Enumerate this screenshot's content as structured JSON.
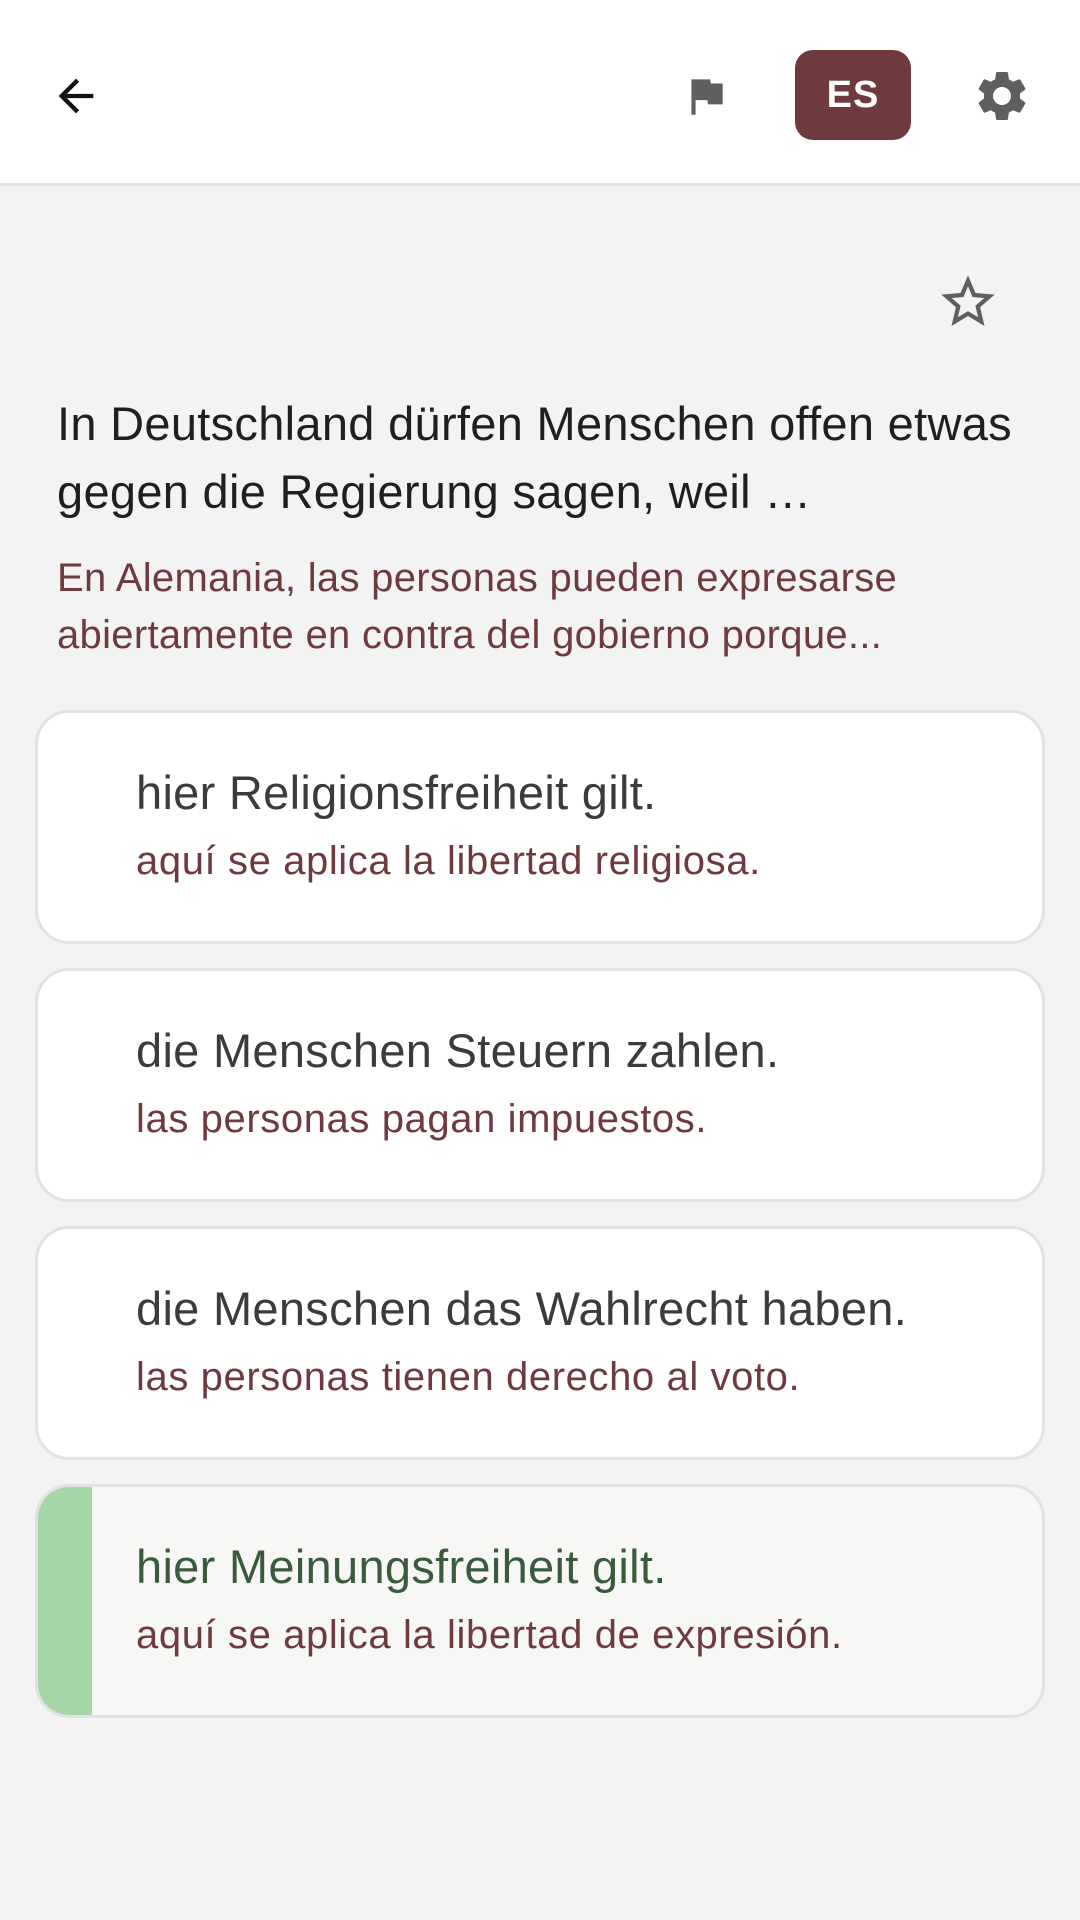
{
  "header": {
    "back_icon": "arrow-left-icon",
    "flag_icon": "flag-icon",
    "language_label": "ES",
    "settings_icon": "gear-icon"
  },
  "question": {
    "favorite_icon": "star-outline-icon",
    "text": "In Deutschland dürfen Menschen offen etwas gegen die Regierung sagen, weil …",
    "translation": "En Alemania, las personas pueden expresarse abiertamente en contra del gobierno porque..."
  },
  "answers": [
    {
      "text": "hier Religionsfreiheit gilt.",
      "translation": "aquí se aplica la libertad religiosa.",
      "correct": false
    },
    {
      "text": "die Menschen Steuern zahlen.",
      "translation": "las personas pagan impuestos.",
      "correct": false
    },
    {
      "text": "die Menschen das Wahlrecht haben.",
      "translation": "las personas tienen derecho al voto.",
      "correct": false
    },
    {
      "text": "hier Meinungsfreiheit gilt.",
      "translation": "aquí se aplica la libertad de expresión.",
      "correct": true
    }
  ],
  "colors": {
    "accent": "#6e3a3e",
    "correct_indicator": "#a5d6a7",
    "background": "#f3f3f3"
  }
}
